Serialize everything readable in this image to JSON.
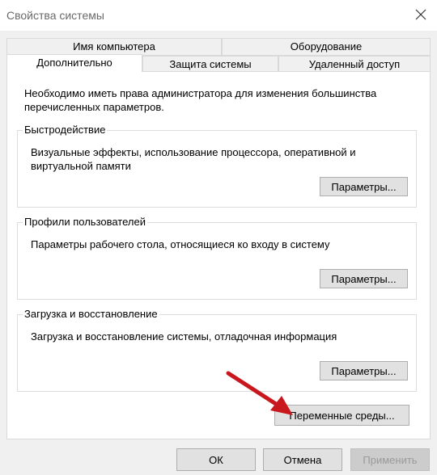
{
  "window": {
    "title": "Свойства системы"
  },
  "tabs_row1": [
    {
      "label": "Имя компьютера"
    },
    {
      "label": "Оборудование"
    }
  ],
  "tabs_row2": [
    {
      "label": "Дополнительно",
      "active": true
    },
    {
      "label": "Защита системы"
    },
    {
      "label": "Удаленный доступ"
    }
  ],
  "panel": {
    "intro": "Необходимо иметь права администратора для изменения большинства перечисленных параметров.",
    "groups": [
      {
        "legend": "Быстродействие",
        "description": "Визуальные эффекты, использование процессора, оперативной и виртуальной памяти",
        "button": "Параметры..."
      },
      {
        "legend": "Профили пользователей",
        "description": "Параметры рабочего стола, относящиеся ко входу в систему",
        "button": "Параметры..."
      },
      {
        "legend": "Загрузка и восстановление",
        "description": "Загрузка и восстановление системы, отладочная информация",
        "button": "Параметры..."
      }
    ],
    "env_button": "Переменные среды..."
  },
  "footer": {
    "ok": "ОК",
    "cancel": "Отмена",
    "apply": "Применить"
  },
  "colors": {
    "arrow": "#c8171d",
    "active_tab": "#ffffff",
    "dialog_bg": "#f0f0f0"
  }
}
